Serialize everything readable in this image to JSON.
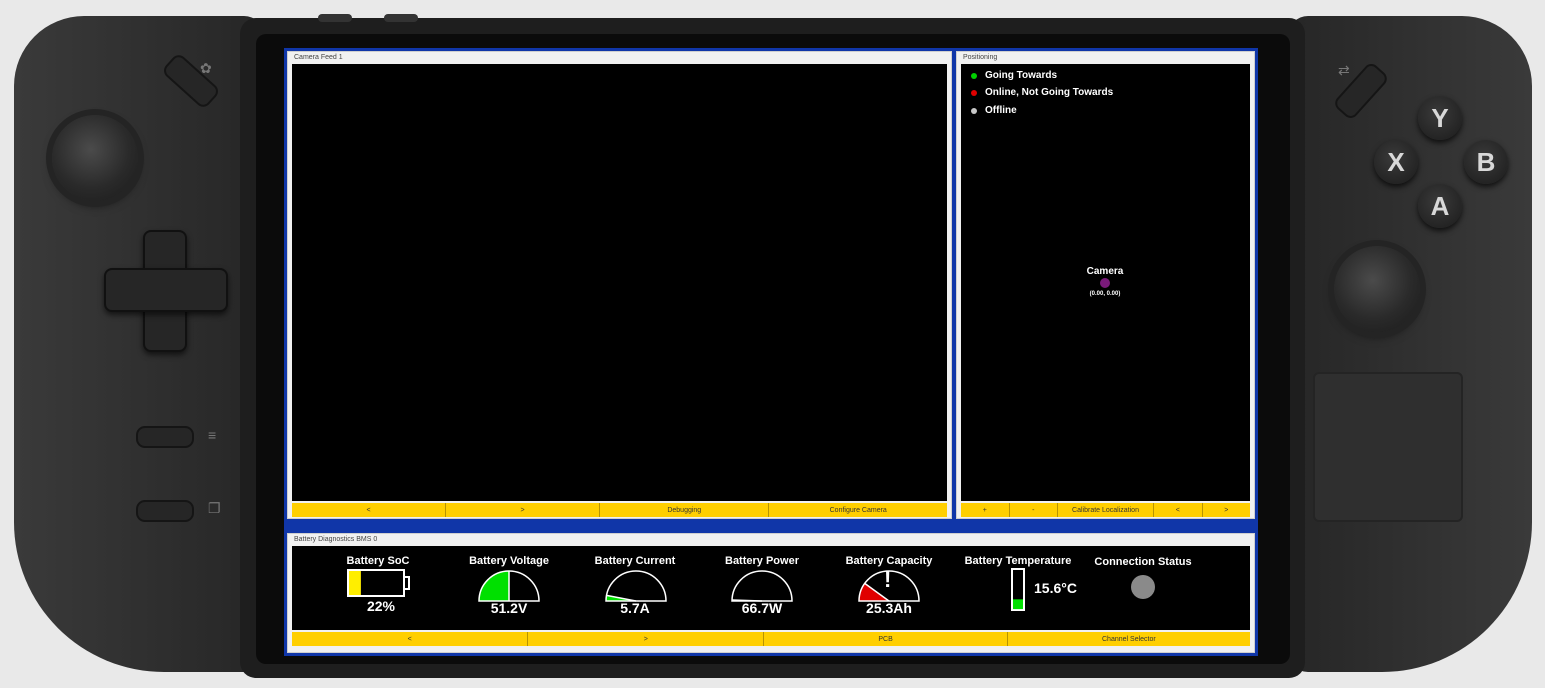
{
  "camera_panel": {
    "title": "Camera Feed 1",
    "buttons": [
      "<",
      ">",
      "Debugging",
      "Configure Camera"
    ]
  },
  "positioning_panel": {
    "title": "Positioning",
    "legend": [
      {
        "label": "Going Towards",
        "color": "#00d000"
      },
      {
        "label": "Online, Not Going Towards",
        "color": "#e00000"
      },
      {
        "label": "Offline",
        "color": "#c8c8c8"
      }
    ],
    "marker": {
      "label": "Camera",
      "coords": "(0.00, 0.00)",
      "color": "#7a1a7a"
    },
    "buttons": [
      "+",
      "-",
      "Calibrate Localization",
      "<",
      ">"
    ]
  },
  "battery_panel": {
    "title": "Battery Diagnostics BMS 0",
    "gauges": {
      "soc": {
        "title": "Battery SoC",
        "value": "22%",
        "fraction": 0.22
      },
      "voltage": {
        "title": "Battery Voltage",
        "value": "51.2V",
        "fraction": 0.5
      },
      "current": {
        "title": "Battery Current",
        "value": "5.7A",
        "fraction": 0.06
      },
      "power": {
        "title": "Battery Power",
        "value": "66.7W",
        "fraction": 0.01
      },
      "capacity": {
        "title": "Battery Capacity",
        "value": "25.3Ah",
        "fraction": 0.2
      },
      "temperature": {
        "title": "Battery Temperature",
        "value": "15.6°C",
        "fraction": 0.25
      },
      "connection": {
        "title": "Connection Status"
      }
    },
    "buttons": [
      "<",
      ">",
      "PCB",
      "Channel Selector"
    ]
  },
  "colors": {
    "accent_yellow": "#ffcf00",
    "frame_blue": "#1036a8",
    "gauge_green": "#00e000",
    "gauge_red": "#e00000"
  },
  "device": {
    "face_buttons": [
      "Y",
      "X",
      "B",
      "A"
    ]
  }
}
